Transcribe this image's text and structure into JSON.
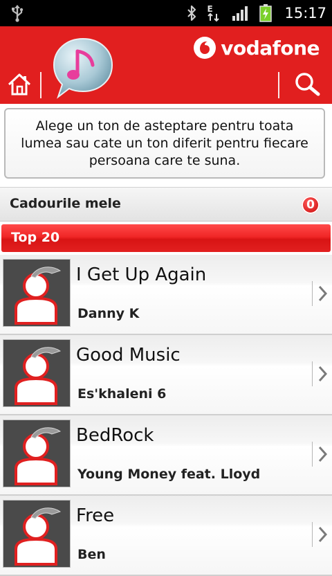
{
  "status_bar": {
    "time": "15:17",
    "network_type": "E",
    "icons": [
      "usb-icon",
      "bluetooth-icon",
      "data-arrows-icon",
      "signal-icon",
      "battery-charging-icon"
    ]
  },
  "header": {
    "brand": "vodafone",
    "icons": [
      "home-icon",
      "music-note-bubble-icon",
      "search-icon",
      "vodafone-logo"
    ],
    "accent_color": "#e11f1f"
  },
  "info": {
    "text": "Alege un ton de asteptare pentru toata lumea sau cate un ton diferit pentru fiecare persoana care te suna."
  },
  "gifts": {
    "label": "Cadourile mele",
    "count": "0"
  },
  "section": {
    "label": "Top 20"
  },
  "songs": [
    {
      "title": "I Get Up Again",
      "artist": "Danny K"
    },
    {
      "title": "Good Music",
      "artist": "Es'khaleni 6"
    },
    {
      "title": "BedRock",
      "artist": "Young Money feat. Lloyd"
    },
    {
      "title": "Free",
      "artist": "Ben"
    }
  ]
}
